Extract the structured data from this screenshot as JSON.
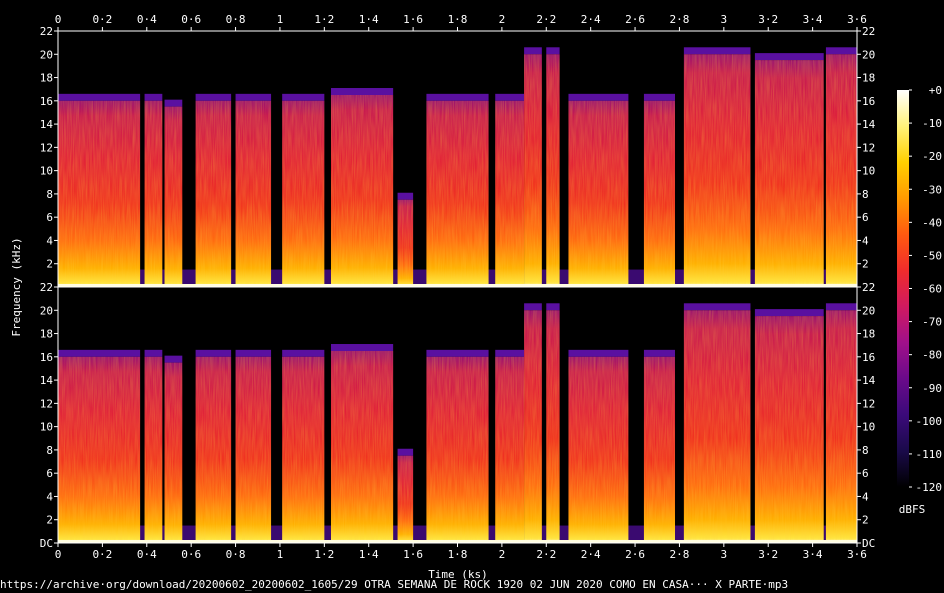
{
  "chart_data": {
    "type": "heatmap",
    "xlabel": "Time (ks)",
    "ylabel": "Frequency (kHz)",
    "xlim": [
      0,
      3.6
    ],
    "ylim": [
      0,
      22
    ],
    "x_ticks": [
      "0",
      "0·2",
      "0·4",
      "0·6",
      "0·8",
      "1",
      "1·2",
      "1·4",
      "1·6",
      "1·8",
      "2",
      "2·2",
      "2·4",
      "2·6",
      "2·8",
      "3",
      "3·2",
      "3·4",
      "3·6"
    ],
    "x_tick_values": [
      0,
      0.2,
      0.4,
      0.6,
      0.8,
      1.0,
      1.2,
      1.4,
      1.6,
      1.8,
      2.0,
      2.2,
      2.4,
      2.6,
      2.8,
      3.0,
      3.2,
      3.4,
      3.6
    ],
    "y_ticks": [
      "DC",
      "2",
      "4",
      "6",
      "8",
      "10",
      "12",
      "14",
      "16",
      "18",
      "20",
      "22"
    ],
    "y_tick_values": [
      0,
      2,
      4,
      6,
      8,
      10,
      12,
      14,
      16,
      18,
      20,
      22
    ],
    "channels": 2,
    "colorbar": {
      "unit": "dBFS",
      "ticks": [
        "+0",
        "-10",
        "-20",
        "-30",
        "-40",
        "-50",
        "-60",
        "-70",
        "-80",
        "-90",
        "-100",
        "-110",
        "-120"
      ],
      "tick_values": [
        0,
        -10,
        -20,
        -30,
        -40,
        -50,
        -60,
        -70,
        -80,
        -90,
        -100,
        -110,
        -120
      ],
      "range": [
        -120,
        0
      ],
      "colors": [
        "#000000",
        "#1a0a4a",
        "#3b0a7a",
        "#6a0a8a",
        "#a0108a",
        "#d01a60",
        "#f02c2c",
        "#ff5a10",
        "#ff9a00",
        "#ffd000",
        "#fff27a",
        "#ffffff"
      ]
    },
    "segments": [
      {
        "start": 0.0,
        "end": 0.37,
        "cutoff_khz": 16
      },
      {
        "start": 0.39,
        "end": 0.47,
        "cutoff_khz": 16
      },
      {
        "start": 0.48,
        "end": 0.56,
        "cutoff_khz": 15.5
      },
      {
        "start": 0.62,
        "end": 0.78,
        "cutoff_khz": 16
      },
      {
        "start": 0.8,
        "end": 0.96,
        "cutoff_khz": 16
      },
      {
        "start": 1.01,
        "end": 1.2,
        "cutoff_khz": 16
      },
      {
        "start": 1.23,
        "end": 1.51,
        "cutoff_khz": 16.5
      },
      {
        "start": 1.53,
        "end": 1.6,
        "cutoff_khz": 7.5
      },
      {
        "start": 1.66,
        "end": 1.94,
        "cutoff_khz": 16
      },
      {
        "start": 1.97,
        "end": 2.1,
        "cutoff_khz": 16
      },
      {
        "start": 2.1,
        "end": 2.18,
        "cutoff_khz": 20
      },
      {
        "start": 2.2,
        "end": 2.26,
        "cutoff_khz": 20
      },
      {
        "start": 2.3,
        "end": 2.57,
        "cutoff_khz": 16
      },
      {
        "start": 2.64,
        "end": 2.78,
        "cutoff_khz": 16
      },
      {
        "start": 2.82,
        "end": 3.12,
        "cutoff_khz": 20
      },
      {
        "start": 3.14,
        "end": 3.45,
        "cutoff_khz": 19.5
      },
      {
        "start": 3.46,
        "end": 3.6,
        "cutoff_khz": 20
      }
    ]
  },
  "caption": {
    "url": "https://archive·org/download/20200602_20200602_1605/29 OTRA SEMANA DE ROCK 1920 02 JUN 2020 COMO EN CASA··· X PARTE·mp3"
  }
}
